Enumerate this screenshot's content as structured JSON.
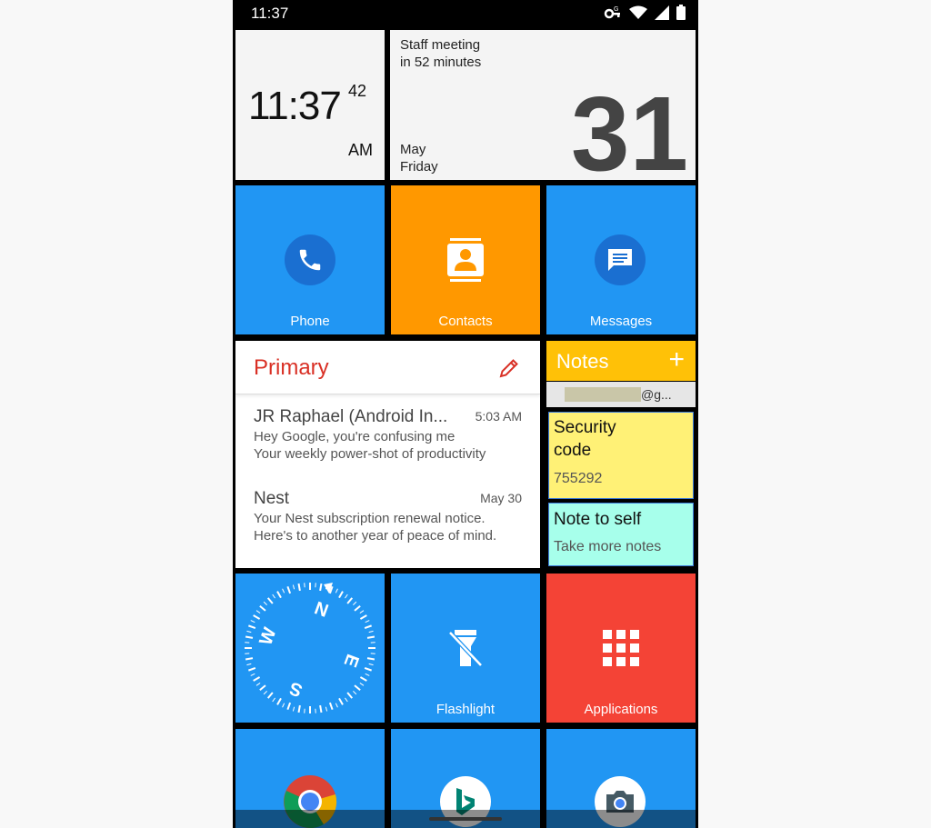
{
  "status_bar": {
    "time": "11:37"
  },
  "clock": {
    "time": "11:37",
    "seconds": "42",
    "ampm": "AM"
  },
  "calendar": {
    "event_line1": "Staff meeting",
    "event_line2": "in 52 minutes",
    "month": "May",
    "weekday": "Friday",
    "day": "31"
  },
  "tiles": {
    "phone": "Phone",
    "contacts": "Contacts",
    "messages": "Messages",
    "flashlight": "Flashlight",
    "applications": "Applications"
  },
  "gmail": {
    "header": "Primary",
    "emails": [
      {
        "sender": "JR Raphael (Android In...",
        "time": "5:03 AM",
        "subject": "Hey Google, you're confusing me",
        "snippet": "Your weekly power-shot of productivity"
      },
      {
        "sender": "Nest",
        "time": "May 30",
        "subject": "Your Nest subscription renewal notice.",
        "snippet": "Here's to another year of peace of mind."
      }
    ]
  },
  "notes": {
    "title": "Notes",
    "add_symbol": "+",
    "account_suffix": "@g...",
    "items": [
      {
        "title_line1": "Security",
        "title_line2": "code",
        "body": "755292"
      },
      {
        "title": "Note to self",
        "body": "Take more notes"
      }
    ]
  },
  "compass": {
    "n": "N",
    "e": "E",
    "s": "S",
    "w": "W"
  },
  "colors": {
    "blue": "#2196f3",
    "orange": "#ff9800",
    "red": "#f44336",
    "notes_amber": "#ffc107",
    "note_yellow": "#fff176",
    "note_teal": "#a7ffeb",
    "gmail_red": "#d93025"
  },
  "icons": [
    "wifi-icon",
    "signal-icon",
    "battery-icon",
    "vpn-key-icon",
    "phone-icon",
    "contacts-icon",
    "messages-icon",
    "edit-icon",
    "flashlight-icon",
    "apps-grid-icon",
    "chrome-icon",
    "bing-icon",
    "camera-icon"
  ]
}
